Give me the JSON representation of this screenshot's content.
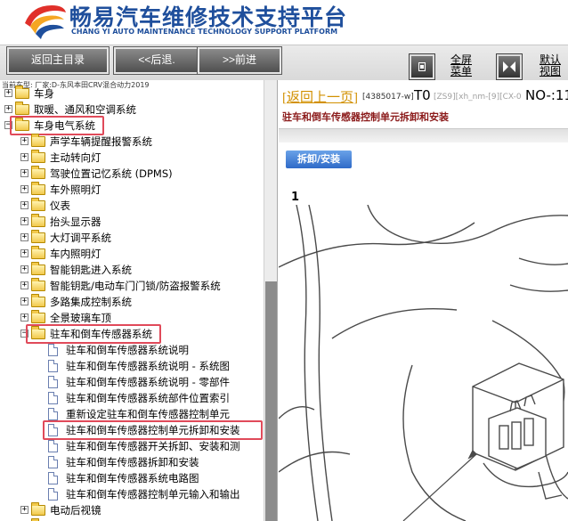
{
  "header": {
    "title_cn": "畅易汽车维修技术支持平台",
    "title_en": "CHANG YI AUTO MAINTENANCE TECHNOLOGY SUPPORT PLATFORM",
    "brand_blue": "#1f4f9c",
    "logo_colors": [
      "#e0302a",
      "#f5a623",
      "#1f4f9c"
    ]
  },
  "toolbar": {
    "home_label": "返回主目录",
    "back_label": "<<后退.",
    "forward_label": ">>前进",
    "fullscreen_line1": "全屏",
    "fullscreen_line2": "菜单",
    "default_line1": "默认",
    "default_line2": "视图"
  },
  "left_pane": {
    "current_model": "当前车型:  厂家:D-东风本田CRV混合动力2019",
    "highlight_color": "#e04a5a",
    "tree": [
      {
        "level": 0,
        "type": "folder",
        "expand": "+",
        "label": "车身"
      },
      {
        "level": 0,
        "type": "folder",
        "expand": "+",
        "label": "取暖、通风和空调系统"
      },
      {
        "level": 0,
        "type": "folder",
        "expand": "−",
        "label": "车身电气系统",
        "highlighted": true
      },
      {
        "level": 1,
        "type": "folder",
        "expand": "+",
        "label": "声学车辆提醒报警系统"
      },
      {
        "level": 1,
        "type": "folder",
        "expand": "+",
        "label": "主动转向灯"
      },
      {
        "level": 1,
        "type": "folder",
        "expand": "+",
        "label": "驾驶位置记忆系统 (DPMS)"
      },
      {
        "level": 1,
        "type": "folder",
        "expand": "+",
        "label": "车外照明灯"
      },
      {
        "level": 1,
        "type": "folder",
        "expand": "+",
        "label": "仪表"
      },
      {
        "level": 1,
        "type": "folder",
        "expand": "+",
        "label": "抬头显示器"
      },
      {
        "level": 1,
        "type": "folder",
        "expand": "+",
        "label": "大灯调平系统"
      },
      {
        "level": 1,
        "type": "folder",
        "expand": "+",
        "label": "车内照明灯"
      },
      {
        "level": 1,
        "type": "folder",
        "expand": "+",
        "label": "智能钥匙进入系统"
      },
      {
        "level": 1,
        "type": "folder",
        "expand": "+",
        "label": "智能钥匙/电动车门门锁/防盗报警系统"
      },
      {
        "level": 1,
        "type": "folder",
        "expand": "+",
        "label": "多路集成控制系统"
      },
      {
        "level": 1,
        "type": "folder",
        "expand": "+",
        "label": "全景玻璃车顶"
      },
      {
        "level": 1,
        "type": "folder",
        "expand": "−",
        "label": "驻车和倒车传感器系统",
        "highlighted": true
      },
      {
        "level": 2,
        "type": "page",
        "label": "驻车和倒车传感器系统说明"
      },
      {
        "level": 2,
        "type": "page",
        "label": "驻车和倒车传感器系统说明 - 系统图"
      },
      {
        "level": 2,
        "type": "page",
        "label": "驻车和倒车传感器系统说明 - 零部件"
      },
      {
        "level": 2,
        "type": "page",
        "label": "驻车和倒车传感器系统部件位置索引"
      },
      {
        "level": 2,
        "type": "page",
        "label": "重新设定驻车和倒车传感器控制单元"
      },
      {
        "level": 2,
        "type": "page",
        "label": "驻车和倒车传感器控制单元拆卸和安装",
        "highlighted": true
      },
      {
        "level": 2,
        "type": "page",
        "label": "驻车和倒车传感器开关拆卸、安装和测"
      },
      {
        "level": 2,
        "type": "page",
        "label": "驻车和倒车传感器拆卸和安装"
      },
      {
        "level": 2,
        "type": "page",
        "label": "驻车和倒车传感器系统电路图"
      },
      {
        "level": 2,
        "type": "page",
        "label": "驻车和倒车传感器控制单元输入和输出"
      },
      {
        "level": 1,
        "type": "folder",
        "expand": "+",
        "label": "电动后视镜"
      },
      {
        "level": 1,
        "type": "folder",
        "expand": "+",
        "label": "电动车窗"
      }
    ]
  },
  "right_pane": {
    "back_link": "返回上一页",
    "doc_code": "[4385017-w]",
    "doc_t0": "T0",
    "doc_grey": "[ZS9][xh_nm-[9][CX-0",
    "doc_no": "NO-:11",
    "doc_title": "驻车和倒车传感器控制单元拆卸和安装",
    "tab_label": "拆卸/安装",
    "step_number": "1",
    "title_color": "#8b1a1a",
    "link_color": "#d29000"
  }
}
